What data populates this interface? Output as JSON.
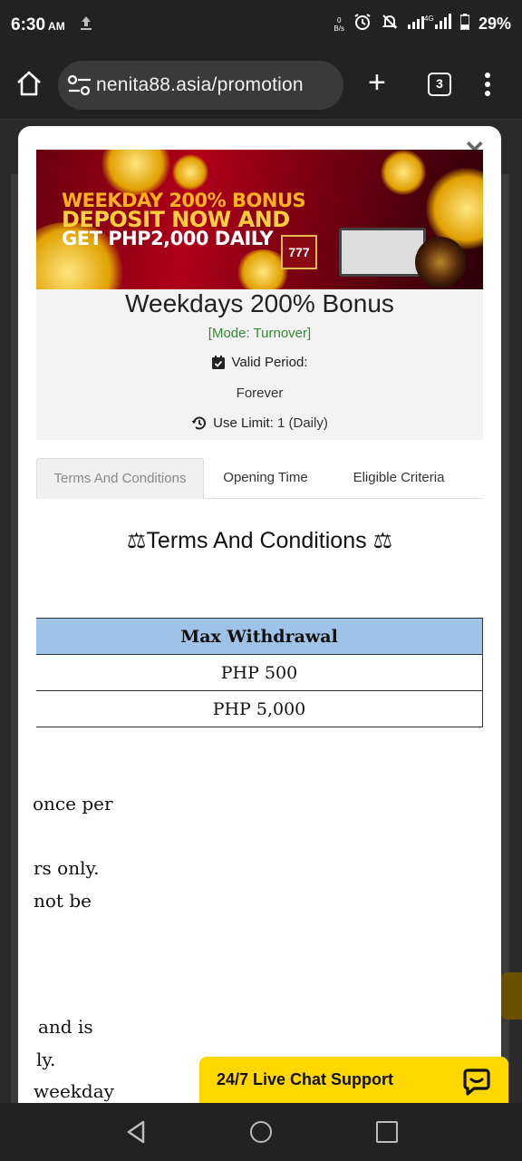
{
  "status_bar": {
    "time": "6:30",
    "ampm": "AM",
    "upload_icon": "upload-arrow-icon",
    "net_speed_value": "0",
    "net_speed_unit": "B/s",
    "network": "4G",
    "battery": "29%"
  },
  "browser": {
    "url": "nenita88.asia/promotion",
    "tab_count": "3"
  },
  "promo": {
    "banner_lines": [
      "WEEKDAY 200% BONUS",
      "DEPOSIT NOW AND",
      "GET PHP2,000 DAILY"
    ],
    "banner_slot": "777",
    "title": "Weekdays 200% Bonus",
    "mode": "[Mode: Turnover]",
    "valid_label": "Valid Period:",
    "valid_value": "Forever",
    "limit_label": "Use Limit:",
    "limit_value": "1 (Daily)"
  },
  "tabs": [
    "Terms And Conditions",
    "Opening Time",
    "Eligible Criteria"
  ],
  "section": {
    "title": "Terms And Conditions",
    "icon": "balance-scale-icon"
  },
  "table": {
    "header": "Max Withdrawal",
    "rows": [
      "PHP 500",
      "PHP 5,000"
    ]
  },
  "body_fragments": [
    "once per",
    "rs only.",
    "not be",
    "and is",
    "ly.",
    "weekday"
  ],
  "chat": {
    "label": "24/7 Live Chat Support"
  },
  "colors": {
    "accent_yellow": "#ffd700",
    "table_header": "#9fc3e7",
    "mode_green": "#2f8a2f"
  }
}
